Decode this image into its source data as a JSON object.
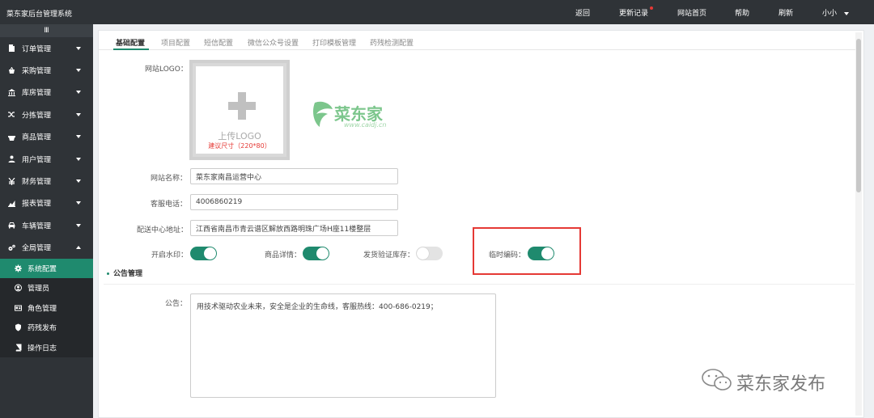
{
  "app": {
    "title": "菜东家后台管理系统"
  },
  "header": {
    "nav": [
      {
        "label": "返回"
      },
      {
        "label": "更新记录"
      },
      {
        "label": "网站首页"
      },
      {
        "label": "帮助"
      },
      {
        "label": "刷新"
      }
    ],
    "user": "小小"
  },
  "sidebar": {
    "toggle_glyph": "Ⅲ",
    "items": [
      {
        "label": "订单管理",
        "icon": "file-icon"
      },
      {
        "label": "采购管理",
        "icon": "cart-icon"
      },
      {
        "label": "库房管理",
        "icon": "bank-icon"
      },
      {
        "label": "分拣管理",
        "icon": "shuffle-icon"
      },
      {
        "label": "商品管理",
        "icon": "basket-icon"
      },
      {
        "label": "用户管理",
        "icon": "users-icon"
      },
      {
        "label": "财务管理",
        "icon": "yuan-icon"
      },
      {
        "label": "报表管理",
        "icon": "chart-icon"
      },
      {
        "label": "车辆管理",
        "icon": "car-icon"
      },
      {
        "label": "全局管理",
        "icon": "gears-icon"
      }
    ],
    "sub_items": [
      {
        "label": "系统配置",
        "icon": "gear-icon"
      },
      {
        "label": "管理员",
        "icon": "user-circle-icon"
      },
      {
        "label": "角色管理",
        "icon": "id-card-icon"
      },
      {
        "label": "药残发布",
        "icon": "shield-icon"
      },
      {
        "label": "操作日志",
        "icon": "book-icon"
      }
    ]
  },
  "tabs": [
    {
      "label": "基础配置"
    },
    {
      "label": "项目配置"
    },
    {
      "label": "短信配置"
    },
    {
      "label": "微信公众号设置"
    },
    {
      "label": "打印模板管理"
    },
    {
      "label": "药残检测配置"
    }
  ],
  "form": {
    "logo_label": "网站LOGO：",
    "upload_text": "上传LOGO",
    "upload_hint": "建议尺寸（220*80）",
    "logo_brand": "菜东家",
    "logo_url": "www.caidj.cn",
    "site_name_label": "网站名称：",
    "site_name_value": "菜东家南昌运营中心",
    "phone_label": "客服电话：",
    "phone_value": "4006860219",
    "address_label": "配送中心地址：",
    "address_value": "江西省南昌市青云谱区解放西路明珠广场H座11楼整层",
    "toggles": [
      {
        "label": "开启水印：",
        "on": true
      },
      {
        "label": "商品详情：",
        "on": true
      },
      {
        "label": "发货验证库存：",
        "on": false
      },
      {
        "label": "临时编码：",
        "on": true
      }
    ]
  },
  "notice": {
    "section_title": "公告管理",
    "label": "公告：",
    "value": "用技术驱动农业未来，安全是企业的生命线，客服热线：400-686-0219；"
  },
  "watermark": {
    "text": "菜东家发布"
  },
  "colors": {
    "accent": "#1f8a6e",
    "topbar": "#2f3337",
    "highlight": "#e53935"
  }
}
